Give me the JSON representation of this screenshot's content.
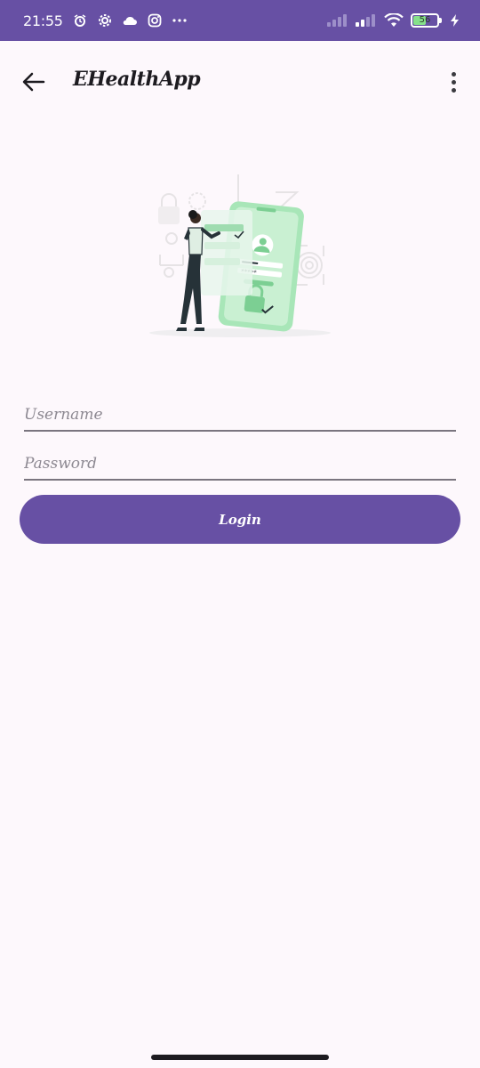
{
  "status_bar": {
    "time": "21:55",
    "battery_level": "56",
    "battery_fraction": 0.56,
    "icons_left": [
      "alarm-icon",
      "settings-icon",
      "cloud-icon",
      "instagram-icon",
      "more-dots-icon"
    ],
    "icons_right": [
      "signal-icon",
      "signal-icon",
      "wifi-icon",
      "battery-icon",
      "charging-icon"
    ]
  },
  "app_bar": {
    "title": "EHealthApp",
    "back_icon": "arrow-left-icon",
    "menu_icon": "more-vert-icon"
  },
  "illustration": {
    "icon": "secure-login-illustration",
    "accent_color": "#a8e6b8"
  },
  "form": {
    "username": {
      "placeholder": "Username",
      "value": ""
    },
    "password": {
      "placeholder": "Password",
      "value": ""
    },
    "login_label": "Login"
  },
  "colors": {
    "primary": "#6750a4",
    "background": "#fdf8fc",
    "underline": "#7a757f",
    "placeholder": "#8d8992"
  }
}
